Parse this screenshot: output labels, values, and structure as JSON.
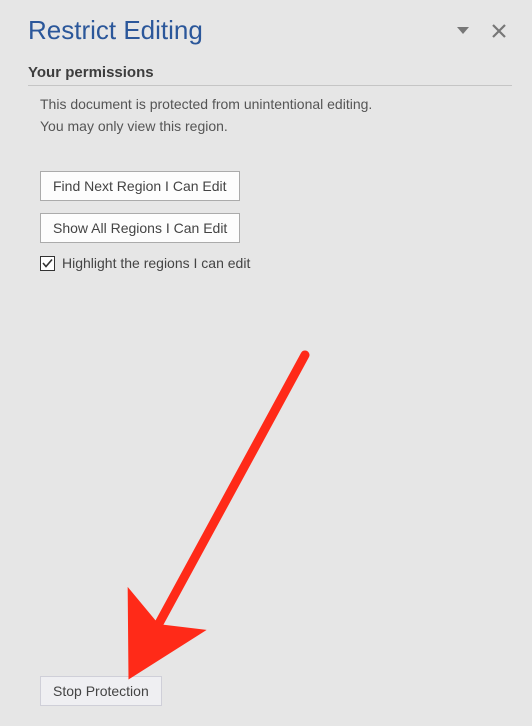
{
  "pane": {
    "title": "Restrict Editing"
  },
  "section": {
    "heading": "Your permissions",
    "line1": "This document is protected from unintentional editing.",
    "line2": "You may only view this region."
  },
  "buttons": {
    "findNext": "Find Next Region I Can Edit",
    "showAll": "Show All Regions I Can Edit",
    "stopProtection": "Stop Protection"
  },
  "checkbox": {
    "highlightLabel": "Highlight the regions I can edit",
    "checked": true
  },
  "annotation": {
    "arrowColor": "#ff2a18"
  }
}
